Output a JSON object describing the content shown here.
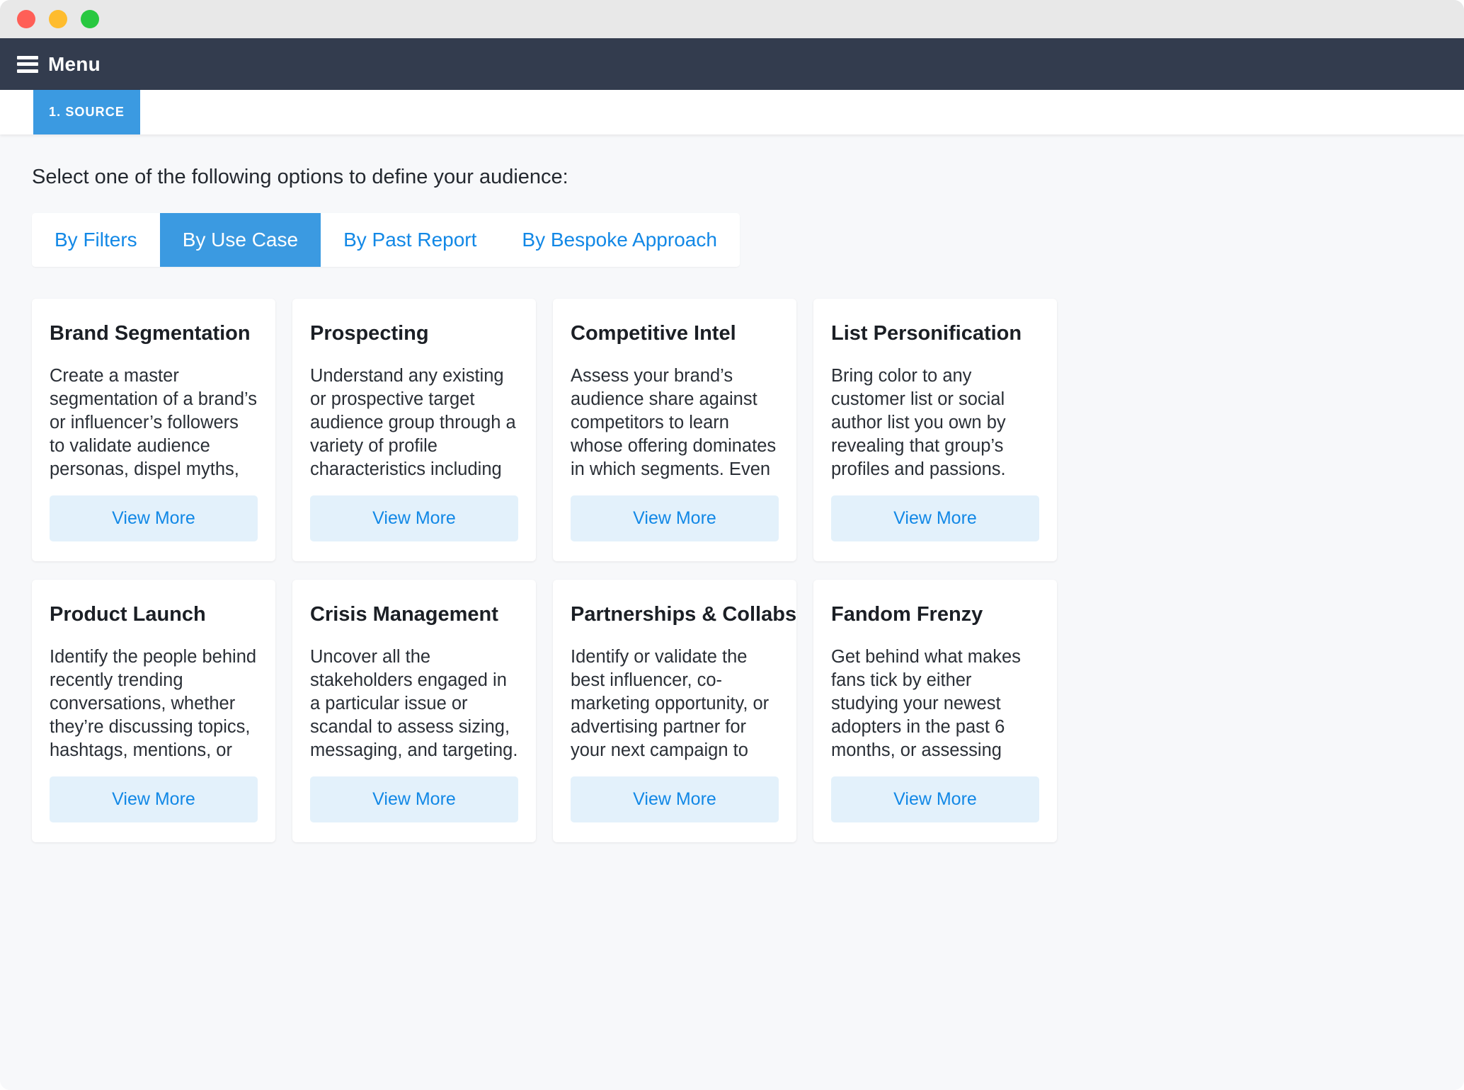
{
  "window": {
    "traffic_lights": [
      {
        "name": "close",
        "color": "#ff5f57"
      },
      {
        "name": "minimize",
        "color": "#febc2e"
      },
      {
        "name": "maximize",
        "color": "#28c840"
      }
    ]
  },
  "header": {
    "menu_icon": "hamburger-icon",
    "menu_label": "Menu",
    "background": "#333c4e"
  },
  "stepbar": {
    "active_step": "1. SOURCE",
    "accent": "#3b9ae1"
  },
  "main": {
    "intro": "Select one of the following options to define your audience:",
    "tabs": [
      {
        "label": "By Filters",
        "active": false
      },
      {
        "label": "By Use Case",
        "active": true
      },
      {
        "label": "By Past Report",
        "active": false
      },
      {
        "label": "By Bespoke Approach",
        "active": false
      }
    ],
    "view_more_label": "View More",
    "cards": [
      {
        "title": "Brand Segmentation",
        "description": "Create a master segmentation of a brand’s or influencer’s followers to validate audience personas, dispel myths, or uncover clusters you didn’t know existed - whether for…"
      },
      {
        "title": "Prospecting",
        "description": "Understand any existing or prospective target audience group through a variety of profile characteristics including passions (i.e. people or things followed), location,…"
      },
      {
        "title": "Competitive Intel",
        "description": "Assess your brand’s audience share against competitors to learn whose offering dominates in which segments. Even evaluate the different assets of your own portfolio."
      },
      {
        "title": "List Personification",
        "description": "Bring color to any customer list or social author list you own by revealing that group’s profiles and passions. Increase the value of your surveys, social listening,…"
      },
      {
        "title": "Product Launch",
        "description": "Identify the people behind recently trending conversations, whether they’re discussing topics, hashtags, mentions, or popular links (like trailer drops or product…"
      },
      {
        "title": "Crisis Management",
        "description": "Uncover all the stakeholders engaged in a particular issue or scandal to assess sizing, messaging, and targeting."
      },
      {
        "title": "Partnerships & Collabs",
        "description": "Identify or validate the best influencer, co-marketing opportunity, or advertising partner for your next campaign to guarantee resonance with your audience."
      },
      {
        "title": "Fandom Frenzy",
        "description": "Get behind what makes fans tick by either studying your newest adopters in the past 6 months, or assessing your most dedicated base who both follow and mention you…"
      }
    ]
  },
  "colors": {
    "accent_blue": "#3b9ae1",
    "link_blue": "#1288e6",
    "button_bg": "#e3f1fb",
    "header_bg": "#333c4e",
    "page_bg": "#f7f8fa"
  }
}
